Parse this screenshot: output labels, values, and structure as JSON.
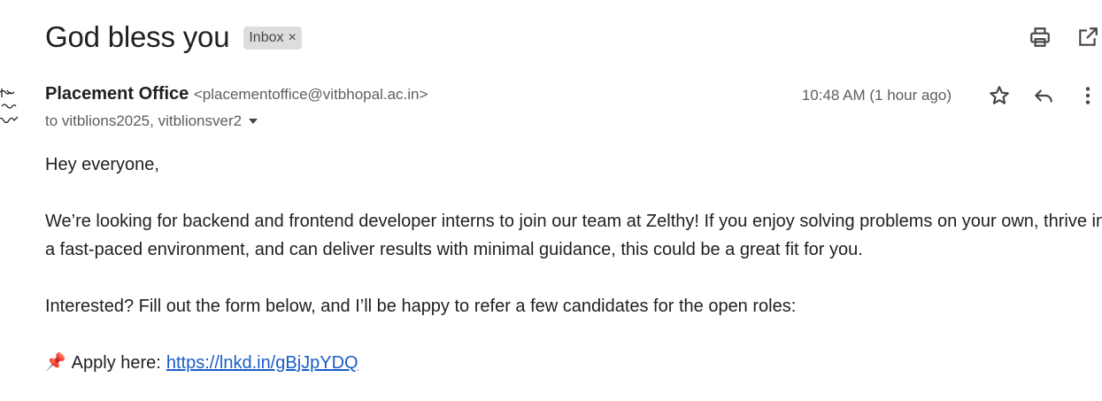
{
  "subject": {
    "title": "God bless you",
    "label": "Inbox",
    "label_remove": "×"
  },
  "top_actions": {
    "print_icon": "print-icon",
    "open_new_window_icon": "open-in-new-window-icon"
  },
  "sender": {
    "name": "Placement Office",
    "email": "<placementoffice@vitbhopal.ac.in>",
    "recipients": "to vitblions2025, vitblionsver2",
    "timestamp": "10:48 AM (1 hour ago)"
  },
  "message_actions": {
    "star_icon": "star-icon",
    "reply_icon": "reply-icon",
    "more_icon": "more-vert-icon"
  },
  "body": {
    "greeting": "Hey everyone,",
    "paragraph1": "We’re looking for backend and frontend developer interns to join our team at Zelthy! If you enjoy solving problems on your own, thrive in a fast-paced environment, and can deliver results with minimal guidance, this could be a great fit for you.",
    "paragraph2": "Interested? Fill out the form below, and I’ll be happy to refer a few candidates for the open roles:",
    "pin": "📌",
    "apply_label": "Apply here:",
    "apply_link": "https://lnkd.in/gBjJpYDQ"
  },
  "colors": {
    "text": "#1f1f1f",
    "secondary_text": "#5e5e5e",
    "link": "#1a5dc7",
    "chip_bg": "#dddddd"
  }
}
